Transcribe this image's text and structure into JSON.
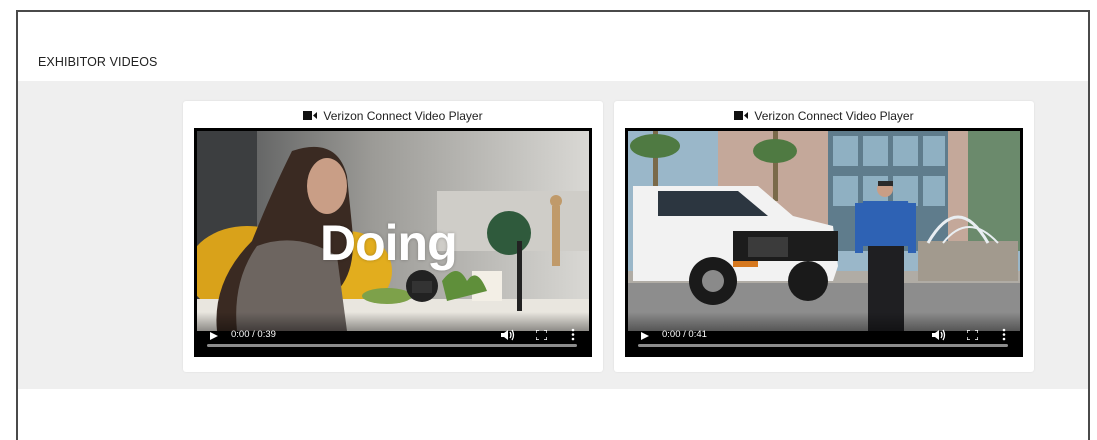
{
  "section": {
    "title": "EXHIBITOR VIDEOS"
  },
  "videos": [
    {
      "player_label": "Verizon Connect Video Player",
      "overlay_text": "Doing",
      "time": "0:00 / 0:39",
      "icon": "video-camera-icon"
    },
    {
      "player_label": "Verizon Connect Video Player",
      "time": "0:00 / 0:41",
      "icon": "video-camera-icon"
    }
  ]
}
